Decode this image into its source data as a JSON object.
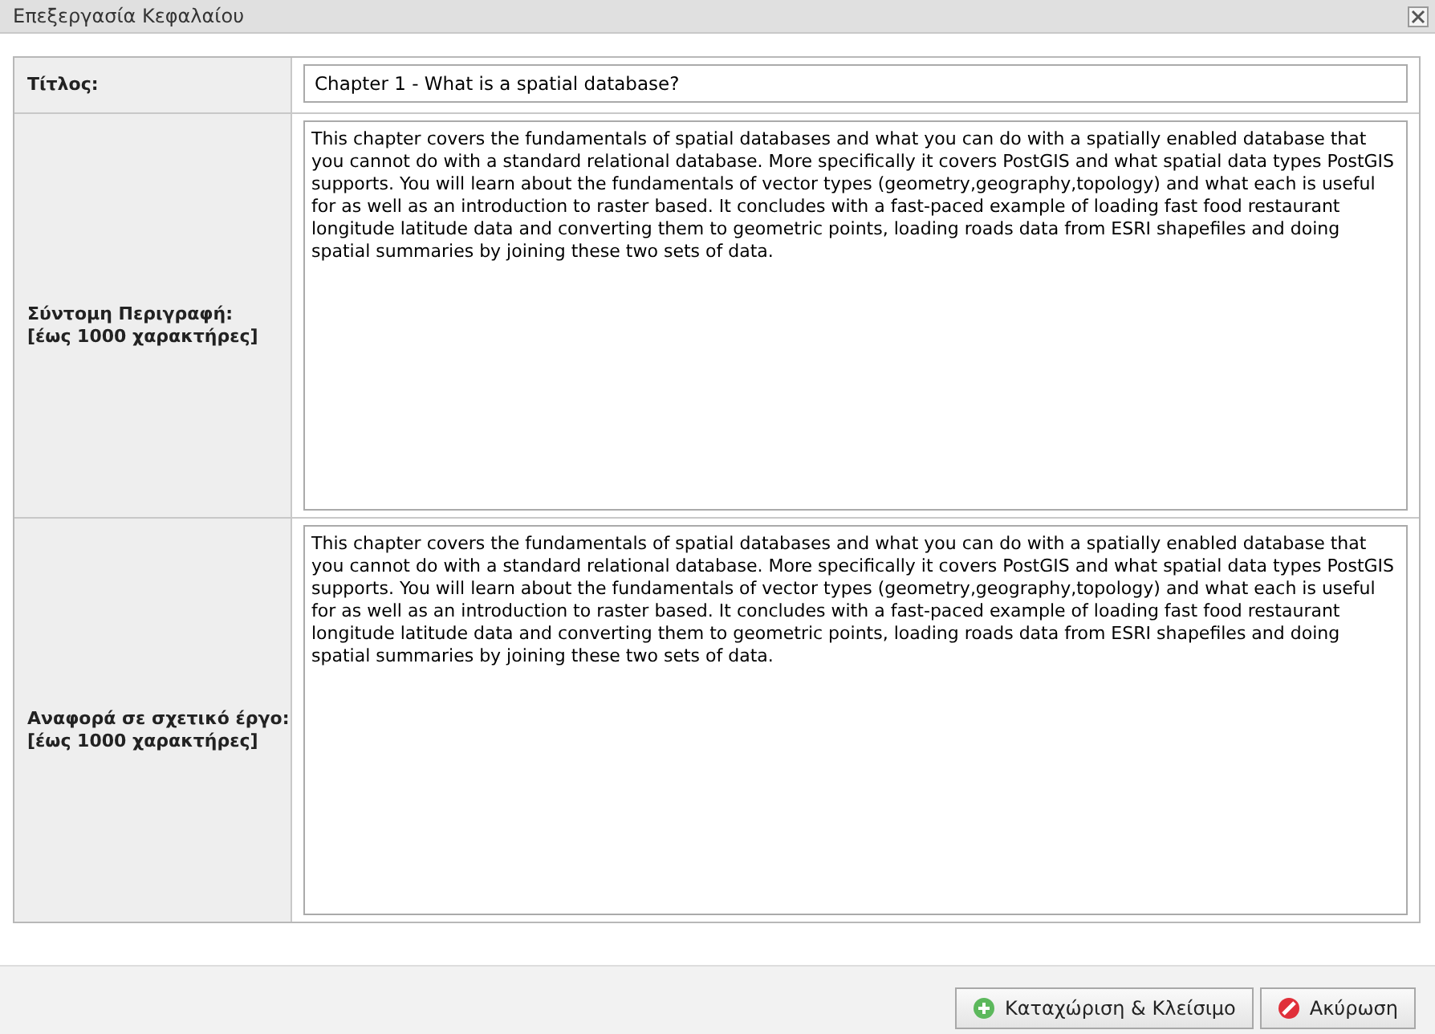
{
  "window": {
    "title": "Επεξεργασία Κεφαλαίου"
  },
  "fields": [
    {
      "kind": "input",
      "label": "Τίτλος:",
      "value": "Chapter 1 - What is a spatial database?"
    },
    {
      "kind": "textarea",
      "label": "Σύντομη Περιγραφή:",
      "hint": "[έως 1000 χαρακτήρες]",
      "value": "This chapter covers the fundamentals of spatial databases and what you can do with a spatially enabled database that you cannot do with a standard relational database. More specifically it covers PostGIS and what spatial data types PostGIS supports. You will learn about the fundamentals of vector types (geometry,geography,topology) and what each is useful for as well as an introduction to raster based. It concludes with a fast-paced example of loading fast food restaurant longitude latitude data and converting them to geometric points, loading roads data from ESRI shapefiles and doing spatial summaries by joining these two sets of data."
    },
    {
      "kind": "textarea",
      "label": "Αναφορά σε σχετικό έργο:",
      "hint": "[έως 1000 χαρακτήρες]",
      "value": "This chapter covers the fundamentals of spatial databases and what you can do with a spatially enabled database that you cannot do with a standard relational database. More specifically it covers PostGIS and what spatial data types PostGIS supports. You will learn about the fundamentals of vector types (geometry,geography,topology) and what each is useful for as well as an introduction to raster based. It concludes with a fast-paced example of loading fast food restaurant longitude latitude data and converting them to geometric points, loading roads data from ESRI shapefiles and doing spatial summaries by joining these two sets of data."
    }
  ],
  "buttons": [
    {
      "kind": "save",
      "label": "Καταχώριση & Κλείσιμο"
    },
    {
      "kind": "cancel",
      "label": "Ακύρωση"
    }
  ]
}
